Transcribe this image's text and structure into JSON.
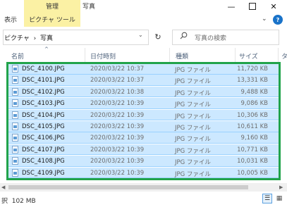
{
  "ribbon": {
    "context_group": "管理",
    "context_tab": "ピクチャ ツール",
    "window_title": "写真",
    "tab_view": "表示",
    "collapse_icon": "chevron-down-icon",
    "help_label": "?"
  },
  "window_controls": {
    "minimize": "—",
    "maximize": "",
    "close": "✕"
  },
  "address": {
    "path": "ピクチャ  ›  写真",
    "dropdown": "⌄",
    "refresh": "↻"
  },
  "search": {
    "placeholder": "写真の検索"
  },
  "columns": {
    "name": "名前",
    "date": "日付時刻",
    "type": "種類",
    "size": "サイズ",
    "overflow": "タ"
  },
  "files": [
    {
      "name": "DSC_4100.JPG",
      "date": "2020/03/22 10:37",
      "type": "JPG ファイル",
      "size": "11,720 KB"
    },
    {
      "name": "DSC_4101.JPG",
      "date": "2020/03/22 10:37",
      "type": "JPG ファイル",
      "size": "13,331 KB"
    },
    {
      "name": "DSC_4102.JPG",
      "date": "2020/03/22 10:38",
      "type": "JPG ファイル",
      "size": "9,488 KB"
    },
    {
      "name": "DSC_4103.JPG",
      "date": "2020/03/22 10:39",
      "type": "JPG ファイル",
      "size": "9,086 KB"
    },
    {
      "name": "DSC_4104.JPG",
      "date": "2020/03/22 10:39",
      "type": "JPG ファイル",
      "size": "10,306 KB"
    },
    {
      "name": "DSC_4105.JPG",
      "date": "2020/03/22 10:39",
      "type": "JPG ファイル",
      "size": "10,611 KB"
    },
    {
      "name": "DSC_4106.JPG",
      "date": "2020/03/22 10:39",
      "type": "JPG ファイル",
      "size": "9,160 KB"
    },
    {
      "name": "DSC_4107.JPG",
      "date": "2020/03/22 10:39",
      "type": "JPG ファイル",
      "size": "10,771 KB"
    },
    {
      "name": "DSC_4108.JPG",
      "date": "2020/03/22 10:39",
      "type": "JPG ファイル",
      "size": "10,031 KB"
    },
    {
      "name": "DSC_4109.JPG",
      "date": "2020/03/22 10:39",
      "type": "JPG ファイル",
      "size": "10,005 KB"
    }
  ],
  "status": {
    "text": "択  102 MB"
  },
  "colors": {
    "selection": "#cce8ff",
    "highlight_box": "#21a34a",
    "context_tab": "#fbf1a4"
  }
}
